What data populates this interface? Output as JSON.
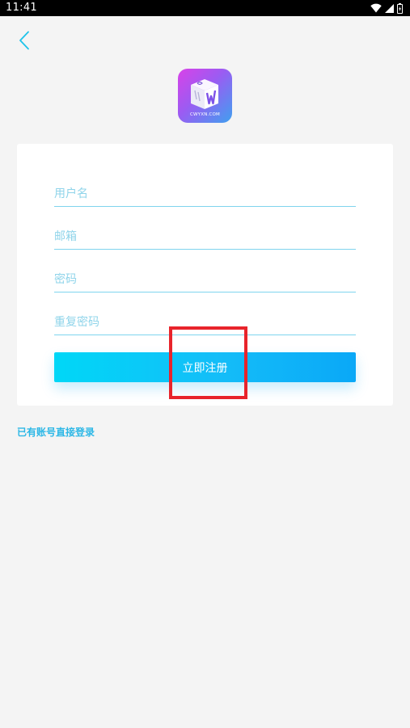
{
  "status_bar": {
    "time": "11:41",
    "icons": [
      "wifi-icon",
      "signal-icon",
      "battery-icon"
    ]
  },
  "header": {
    "back_icon": "chevron-left-icon"
  },
  "logo": {
    "text": "CWYXN.COM"
  },
  "form": {
    "fields": [
      {
        "name": "username",
        "placeholder": "用户名",
        "value": ""
      },
      {
        "name": "email",
        "placeholder": "邮箱",
        "value": ""
      },
      {
        "name": "password",
        "placeholder": "密码",
        "value": ""
      },
      {
        "name": "confirm_password",
        "placeholder": "重复密码",
        "value": ""
      }
    ],
    "submit_label": "立即注册"
  },
  "footer": {
    "login_link": "已有账号直接登录"
  },
  "colors": {
    "accent": "#00c4f5",
    "underline": "#7fd4ee",
    "placeholder": "#8fd4ea",
    "link": "#2cb7e6",
    "highlight": "#e8242b",
    "background": "#f4f4f4"
  }
}
